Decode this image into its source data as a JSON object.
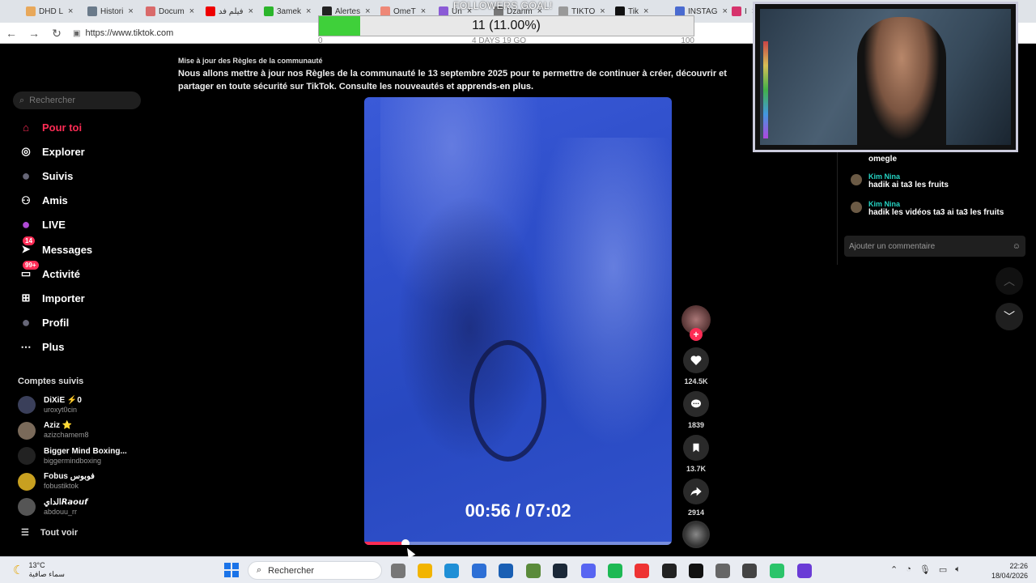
{
  "browser": {
    "tabs": [
      {
        "label": "DHD L",
        "color": "#e8a85a"
      },
      {
        "label": "Histori",
        "color": "#6a7a8a"
      },
      {
        "label": "Docum",
        "color": "#d96a6a"
      },
      {
        "label": "فيلم فد",
        "color": "#e00"
      },
      {
        "label": "3amek",
        "color": "#2bb52b"
      },
      {
        "label": "Alertes",
        "color": "#222"
      },
      {
        "label": "OmeT",
        "color": "#e87"
      },
      {
        "label": "Un",
        "color": "#8b5bd6"
      },
      {
        "label": "Dzarim",
        "color": "#777"
      },
      {
        "label": "TIKTO",
        "color": "#999"
      },
      {
        "label": "Tik",
        "color": "#111"
      },
      {
        "label": "INSTAG",
        "color": "#4a6bd0"
      },
      {
        "label": "I",
        "color": "#d6336c"
      }
    ],
    "url": "https://www.tiktok.com"
  },
  "goal": {
    "title": "FOLLOWERS GOAL!",
    "text": "11 (11.00%)",
    "progress": 0.11,
    "sub_left": "0",
    "sub_mid": "4 DAYS 19 GO",
    "sub_right": "100"
  },
  "notice": {
    "title": "Mise à jour des Règles de la communauté",
    "body": "Nous allons mettre à jour nos Règles de la communauté le 13 septembre 2025 pour te permettre de continuer à créer, découvrir et partager en toute sécurité sur TikTok. Consulte les nouveautés et",
    "link": "apprends-en plus."
  },
  "sidebar": {
    "search_placeholder": "Rechercher",
    "items": [
      {
        "label": "Pour toi",
        "icon": "home-icon"
      },
      {
        "label": "Explorer",
        "icon": "compass-icon"
      },
      {
        "label": "Suivis",
        "icon": "following-avatar-icon"
      },
      {
        "label": "Amis",
        "icon": "friends-icon"
      },
      {
        "label": "LIVE",
        "icon": "live-icon"
      },
      {
        "label": "Messages",
        "icon": "send-icon",
        "badge": "14"
      },
      {
        "label": "Activité",
        "icon": "inbox-icon",
        "badge": "99+"
      },
      {
        "label": "Importer",
        "icon": "plus-box-icon"
      },
      {
        "label": "Profil",
        "icon": "profile-avatar-icon"
      },
      {
        "label": "Plus",
        "icon": "more-dots-icon"
      }
    ],
    "following_title": "Comptes suivis",
    "accounts": [
      {
        "name": "DiXiE ⚡0",
        "handle": "uroxyt0cin"
      },
      {
        "name": "Aziz ⭐",
        "handle": "azizchamem8"
      },
      {
        "name": "Bigger Mind Boxing...",
        "handle": "biggermindboxing"
      },
      {
        "name": "Fobus فوبوس",
        "handle": "fobustiktok"
      },
      {
        "name": "الداي𝙍𝙖𝙤𝙪𝙛",
        "handle": "abdouu_rr"
      }
    ],
    "see_all": "Tout voir"
  },
  "video": {
    "timecode": "00:56 / 07:02",
    "progress": 0.133
  },
  "actions": {
    "likes": "124.5K",
    "comments": "1839",
    "saves": "13.7K",
    "shares": "2914"
  },
  "chat": {
    "partial": "omegle",
    "messages": [
      {
        "user": "Kim Nina",
        "text": "hadik ai ta3 les fruits"
      },
      {
        "user": "Kim Nina",
        "text": "hadik les vidéos ta3 ai ta3 les fruits"
      }
    ],
    "placeholder": "Ajouter un commentaire"
  },
  "taskbar": {
    "temp": "13°C",
    "weather_desc": "سماء صافية",
    "search": "Rechercher",
    "time": "22:26",
    "date": "18/04/2026"
  },
  "colors": {
    "accent": "#fe2c55",
    "goal_fill": "#3fd03a",
    "chat_user": "#25d4c4"
  }
}
